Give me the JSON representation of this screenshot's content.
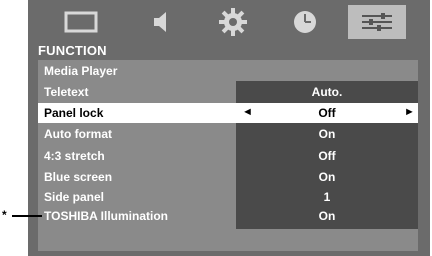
{
  "icons": [
    {
      "name": "picture-icon",
      "selected": false
    },
    {
      "name": "sound-icon",
      "selected": false
    },
    {
      "name": "settings-gear-icon",
      "selected": false
    },
    {
      "name": "timer-clock-icon",
      "selected": false
    },
    {
      "name": "function-sliders-icon",
      "selected": true
    }
  ],
  "menu": {
    "title": "FUNCTION",
    "rows": [
      {
        "label": "Media Player",
        "value": ""
      },
      {
        "label": "Teletext",
        "value": "Auto."
      },
      {
        "label": "Panel lock",
        "value": "Off",
        "selected": true,
        "left_arrow": "◄",
        "right_arrow": "►"
      },
      {
        "label": "Auto format",
        "value": "On"
      },
      {
        "label": "4:3 stretch",
        "value": "Off"
      },
      {
        "label": "Blue screen",
        "value": "On"
      },
      {
        "label": "Side panel",
        "value": "1"
      },
      {
        "label": "TOSHIBA Illumination",
        "value": "On"
      }
    ]
  },
  "footnote_marker": "*",
  "colors": {
    "background": "#6b6b6b",
    "menu": "#8a8a8a",
    "value_column": "#4a4a4a",
    "selected_row": "#ffffff",
    "selected_icon": "#bdbdbd"
  }
}
